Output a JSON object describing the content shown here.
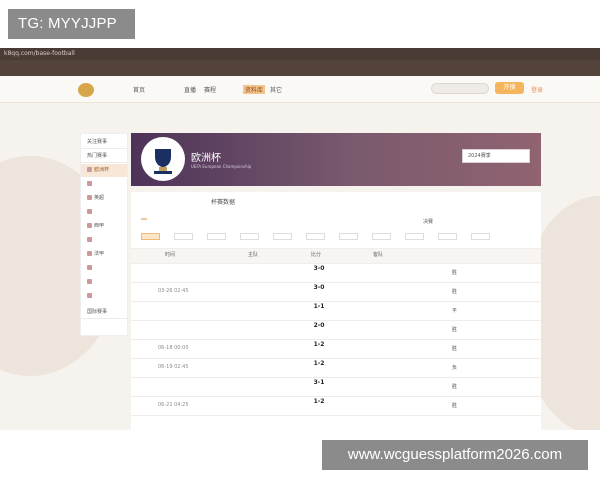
{
  "overlay": {
    "telegram": "TG: MYYJJPP",
    "watermark": "www.wcguessplatform2026.com"
  },
  "browser": {
    "url": "k8qq.com/base-football"
  },
  "topnav": {
    "logo_text": "",
    "items": [
      "首页",
      "",
      "直播",
      "赛程",
      "",
      "资料库",
      "其它"
    ],
    "active_index": 5,
    "search_placeholder": "",
    "open_button": "开搜",
    "login": "登录",
    "accent": "#f4b55c"
  },
  "breadcrumb": "",
  "sidebar": {
    "items": [
      {
        "label": "关注赛事",
        "head": true
      },
      {
        "label": "热门赛事",
        "head": true
      },
      {
        "label": "欧洲杯",
        "selected": true
      },
      {
        "label": "",
        "selected": false
      },
      {
        "label": "英超",
        "selected": false
      },
      {
        "label": "",
        "selected": false
      },
      {
        "label": "西甲",
        "selected": false
      },
      {
        "label": "",
        "selected": false
      },
      {
        "label": "法甲",
        "selected": false
      },
      {
        "label": "",
        "selected": false
      },
      {
        "label": "",
        "selected": false
      },
      {
        "label": "",
        "selected": false
      },
      {
        "label": "国际赛事",
        "head": true
      }
    ]
  },
  "hero": {
    "title": "欧洲杯",
    "subtitle": "UEFA European Championship",
    "season": "2024赛季"
  },
  "tabs": [
    "",
    "",
    "杯赛数据"
  ],
  "stages": [
    "",
    "",
    "",
    "",
    "",
    "",
    "",
    "决赛"
  ],
  "rounds": [
    "",
    "",
    "",
    "",
    "",
    "",
    "",
    "",
    "",
    "",
    ""
  ],
  "table": {
    "headers": [
      "时间",
      "主队",
      "比分",
      "客队",
      "",
      ""
    ],
    "rows": [
      {
        "time": "",
        "home": "",
        "score": "3-0",
        "sub": "",
        "away": "",
        "result": "胜",
        "data": ""
      },
      {
        "time": "03-26 02:45",
        "home": "",
        "score": "3-0",
        "sub": "",
        "away": "",
        "result": "胜",
        "data": ""
      },
      {
        "time": "",
        "home": "",
        "score": "1-1",
        "sub": "",
        "away": "",
        "result": "平",
        "data": ""
      },
      {
        "time": "",
        "home": "",
        "score": "2-0",
        "sub": "",
        "away": "",
        "result": "胜",
        "data": ""
      },
      {
        "time": "06-18 00:00",
        "home": "",
        "score": "1-2",
        "sub": "",
        "away": "",
        "result": "胜",
        "data": ""
      },
      {
        "time": "06-19 02:45",
        "home": "",
        "score": "1-2",
        "sub": "",
        "away": "",
        "result": "负",
        "data": ""
      },
      {
        "time": "",
        "home": "",
        "score": "3-1",
        "sub": "",
        "away": "",
        "result": "胜",
        "data": ""
      },
      {
        "time": "06-21 04:25",
        "home": "",
        "score": "1-2",
        "sub": "",
        "away": "",
        "result": "胜",
        "data": ""
      }
    ]
  }
}
